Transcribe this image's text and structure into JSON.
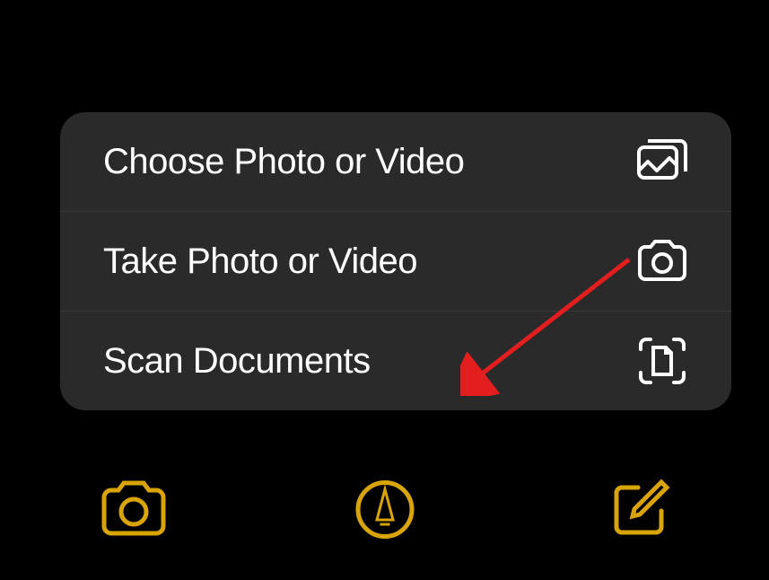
{
  "menu": {
    "items": [
      {
        "label": "Choose Photo or Video",
        "icon": "gallery-icon"
      },
      {
        "label": "Take Photo or Video",
        "icon": "camera-icon"
      },
      {
        "label": "Scan Documents",
        "icon": "scan-document-icon"
      }
    ]
  },
  "toolbar": {
    "camera": "camera-icon",
    "markup": "markup-pen-icon",
    "compose": "compose-icon"
  },
  "colors": {
    "accent": "#d9a406",
    "menu_bg": "#2a2a2a",
    "text": "#ffffff",
    "annotation": "#e41e1e"
  }
}
